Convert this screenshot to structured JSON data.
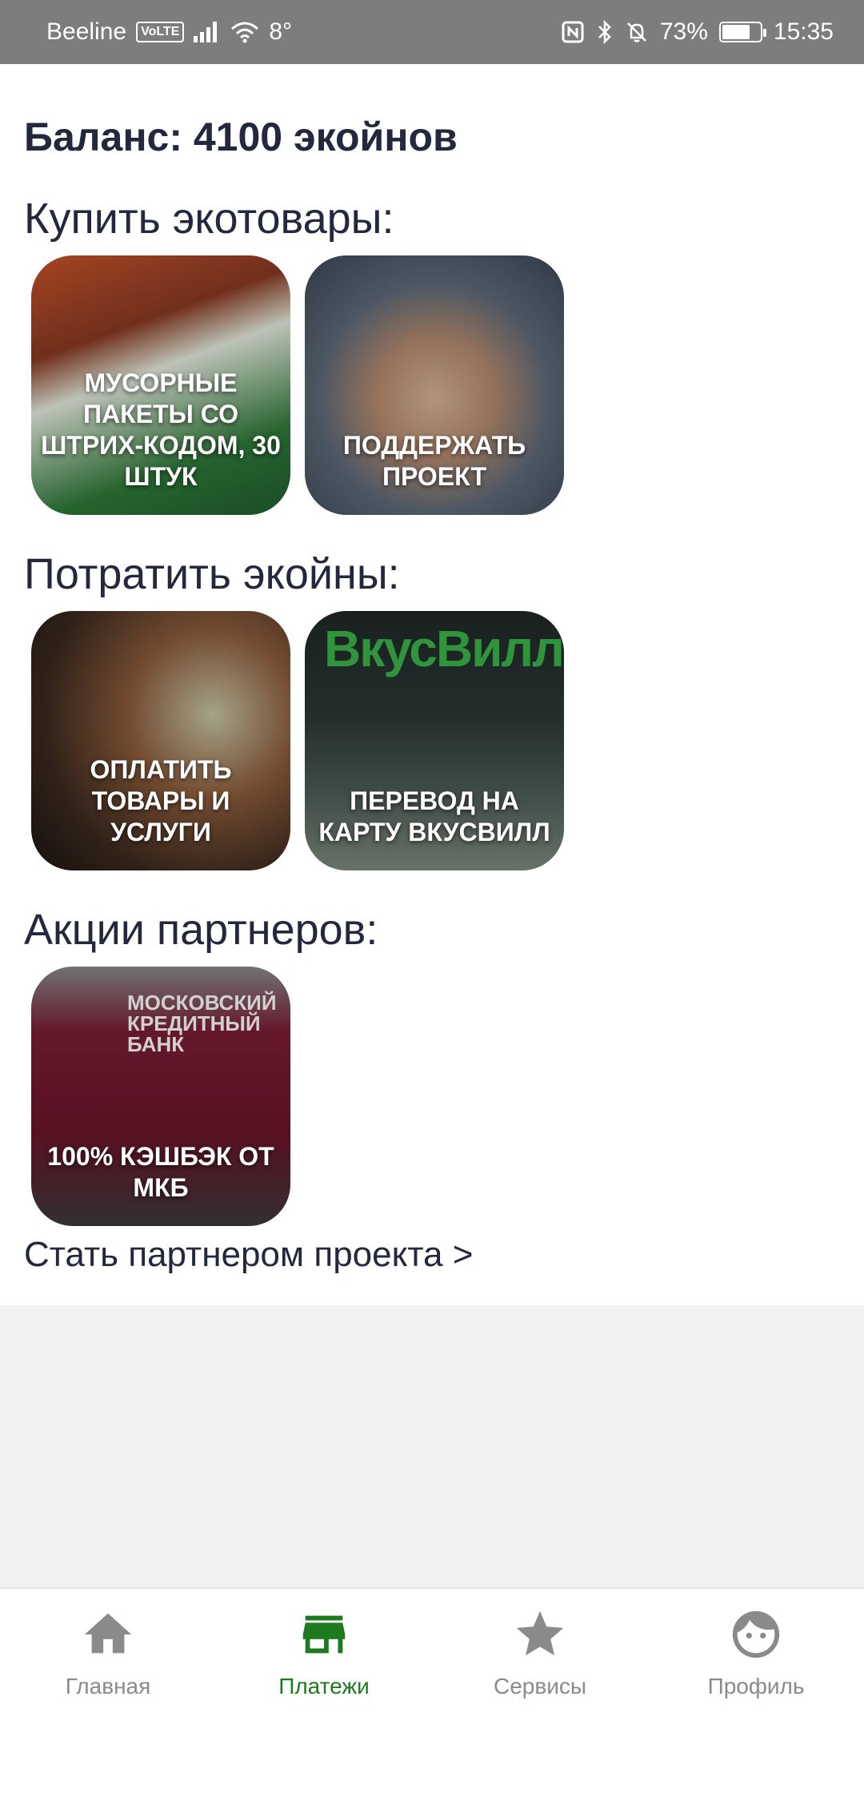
{
  "status_bar": {
    "carrier": "Beeline",
    "volte": "VoLTE",
    "temperature": "8°",
    "battery": "73%",
    "battery_level": 0.73,
    "time": "15:35"
  },
  "balance_label": "Баланс:  4100 экойнов",
  "sections": {
    "buy": {
      "title": "Купить экотовары:",
      "tiles": [
        {
          "label": "Мусорные пакеты со штрих-кодом, 30 штук",
          "image": "trash-bags-image"
        },
        {
          "label": "Поддержать проект",
          "image": "hands-together-image"
        }
      ]
    },
    "spend": {
      "title": "Потратить экойны:",
      "tiles": [
        {
          "label": "Оплатить товары и услуги",
          "image": "phone-payment-image"
        },
        {
          "label": "Перевод на карту ВкусВилл",
          "image": "vkusvill-store-image"
        }
      ],
      "vkusvill_logo_text": "ВкусВилл"
    },
    "partners": {
      "title": "Акции партнеров:",
      "tiles": [
        {
          "label": "100% кэшбэк от МКБ",
          "image": "mkb-bank-image"
        }
      ],
      "mkb_logo_lines": [
        "МОСКОВСКИЙ",
        "КРЕДИТНЫЙ",
        "БАНК"
      ]
    }
  },
  "partner_link": "Стать партнером проекта >",
  "bottom_nav": {
    "items": [
      {
        "label": "Главная",
        "icon": "home-icon",
        "active": false
      },
      {
        "label": "Платежи",
        "icon": "store-icon",
        "active": true
      },
      {
        "label": "Сервисы",
        "icon": "star-icon",
        "active": false
      },
      {
        "label": "Профиль",
        "icon": "face-icon",
        "active": false
      }
    ]
  },
  "colors": {
    "text_primary": "#23283f",
    "nav_active": "#1e7a1e",
    "nav_inactive": "#8a8a8a",
    "status_bar": "#7d7d7d"
  }
}
